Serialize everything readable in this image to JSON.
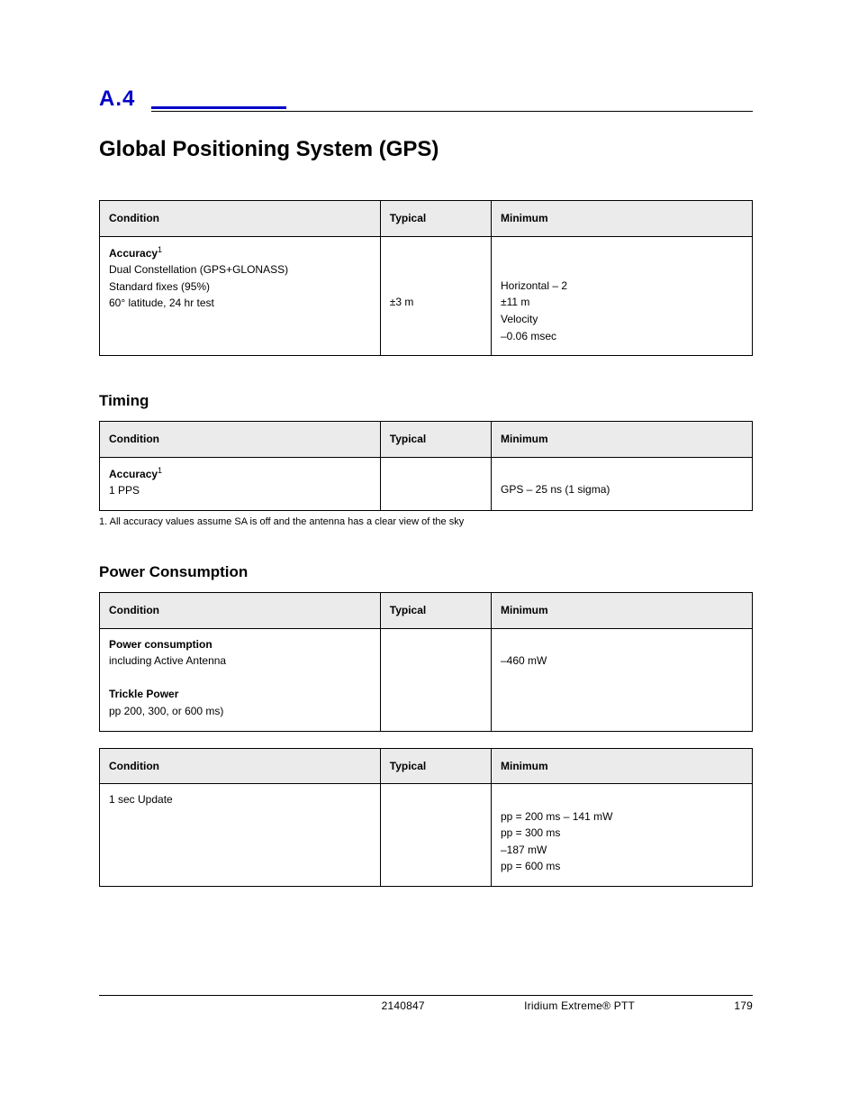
{
  "section": {
    "number": "A.4",
    "title": "Global Positioning System (GPS)"
  },
  "tables": {
    "accuracy": {
      "heading": null,
      "columns": [
        "Condition",
        "Typical",
        "Minimum"
      ],
      "row_heading": "Accuracy",
      "cond": [
        "Dual Constellation (GPS+GLONASS)",
        "Standard fixes (95%)",
        "60° latitude, 24 hr test"
      ],
      "typ": "±3 m",
      "min": [
        "Horizontal – 2",
        "±11 m",
        "Velocity",
        "–0.06 msec"
      ]
    },
    "timing": {
      "heading": "Timing",
      "columns": [
        "Condition",
        "Typical",
        "Minimum"
      ],
      "row_heading": "Accuracy",
      "cond": [
        "1 PPS"
      ],
      "typ": "",
      "min": [
        "GPS – 25 ns (1 sigma)"
      ],
      "footnote": "1. All accuracy values assume SA is off and the antenna has a clear view of the sky"
    },
    "power": {
      "heading": "Power Consumption",
      "columns": [
        "Condition",
        "Typical",
        "Minimum"
      ],
      "row_heading_1": "Power consumption",
      "cond_1": [
        "including Active Antenna"
      ],
      "typ_1": "",
      "min_1": "–460 mW",
      "row_heading_2": "Trickle Power",
      "cond_2": "pp 200, 300, or 600 ms)",
      "typ_2": "",
      "min_2": ""
    },
    "power2": {
      "columns": [
        "Condition",
        "Typical",
        "Minimum"
      ],
      "cond": "1 sec Update",
      "min": [
        "pp = 200 ms – 141 mW",
        "pp = 300 ms",
        "–187 mW",
        "pp = 600 ms"
      ]
    }
  },
  "footer": {
    "code": "2140847",
    "product": "Iridium Extreme® PTT",
    "page": "179"
  }
}
